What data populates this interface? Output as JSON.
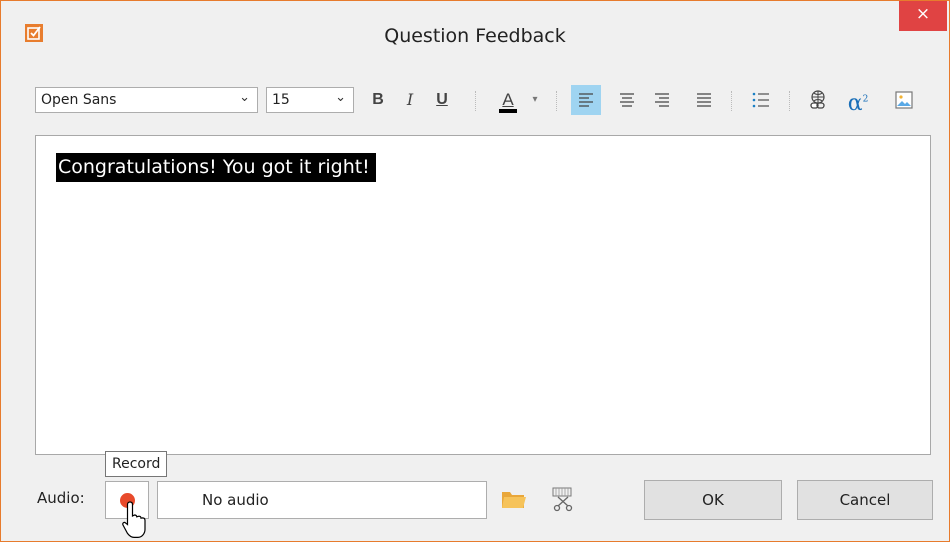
{
  "window": {
    "title": "Question Feedback",
    "close_glyph": "×",
    "accent": "#e87d2e"
  },
  "toolbar": {
    "font_family_value": "Open Sans",
    "font_size_value": "15",
    "bold_label": "B",
    "italic_label": "I",
    "underline_label": "U",
    "font_color_label": "A",
    "font_color": "#000000",
    "align_left_active": true
  },
  "editor": {
    "content": "Congratulations! You got it right!"
  },
  "audio": {
    "label": "Audio:",
    "tooltip": "Record",
    "status_text": "No audio",
    "record_color": "#e84a2b"
  },
  "buttons": {
    "ok": "OK",
    "cancel": "Cancel"
  }
}
